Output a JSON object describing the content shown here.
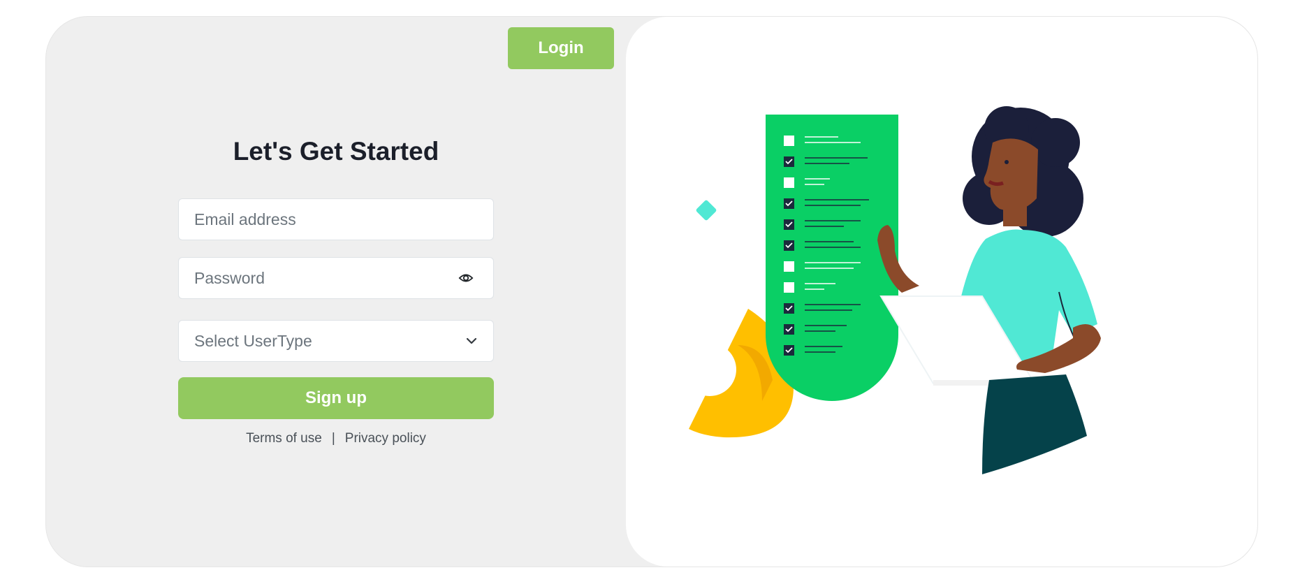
{
  "header": {
    "login_label": "Login"
  },
  "form": {
    "title": "Let's Get Started",
    "email_placeholder": "Email address",
    "password_placeholder": "Password",
    "usertype_placeholder": "Select UserType",
    "signup_label": "Sign up"
  },
  "footer_links": {
    "terms": "Terms of use",
    "separator": "|",
    "privacy": "Privacy policy"
  },
  "icons": {
    "password_toggle": "eye-icon",
    "select_toggle": "chevron-down-icon"
  },
  "colors": {
    "accent": "#92c95f",
    "left_panel_bg": "#efefef",
    "title_text": "#1b1f2a",
    "checklist_green": "#0acf65",
    "teal_shirt": "#50e8d4",
    "yellow_shape": "#ffbf00"
  }
}
